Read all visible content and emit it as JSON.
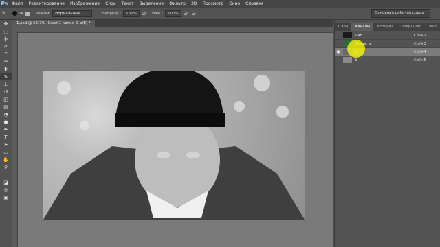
{
  "app": {
    "logo": "Ps"
  },
  "menu": [
    "Файл",
    "Редактирование",
    "Изображение",
    "Слои",
    "Текст",
    "Выделение",
    "Фильтр",
    "3D",
    "Просмотр",
    "Окно",
    "Справка"
  ],
  "options": {
    "brush_size": "24",
    "mode_label": "Режим:",
    "mode_value": "Нормальный",
    "opacity_label": "Непрозр.:",
    "opacity_value": "100%",
    "flow_label": "Наж.:",
    "flow_value": "100%"
  },
  "workspace": "Основная рабочая среда",
  "document": {
    "tab_label": "1.psd @ 66,7% (Слой 1 копия 2, з/8) *"
  },
  "panel": {
    "tabs": [
      "Слои",
      "Каналы",
      "История",
      "Операции",
      "Цвет"
    ],
    "active_tab": 1,
    "channels": [
      {
        "name": "Lab",
        "shortcut": "Ctrl+2",
        "thumb_color": "#1a1a1a"
      },
      {
        "name": "Яркость",
        "shortcut": "Ctrl+3",
        "thumb_color": "#2e6b3b"
      },
      {
        "name": "a",
        "shortcut": "Ctrl+4",
        "thumb_color": "#6a6a6a",
        "selected": true
      },
      {
        "name": "b",
        "shortcut": "Ctrl+5",
        "thumb_color": "#8a8a8a"
      }
    ]
  },
  "colors": {
    "highlight": "#ffff00"
  }
}
